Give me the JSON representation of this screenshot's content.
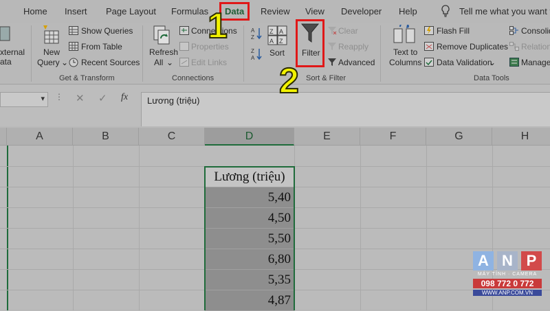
{
  "tabs": {
    "home": "Home",
    "insert": "Insert",
    "page_layout": "Page Layout",
    "formulas": "Formulas",
    "data": "Data",
    "review": "Review",
    "view": "View",
    "developer": "Developer",
    "help": "Help",
    "tell_me": "Tell me what you want to"
  },
  "ribbon": {
    "get_transform": {
      "external_line1": "xternal",
      "external_line2": "ata",
      "new_query_line1": "New",
      "new_query_line2": "Query",
      "show_queries": "Show Queries",
      "from_table": "From Table",
      "recent_sources": "Recent Sources",
      "group_label": "Get & Transform"
    },
    "connections": {
      "refresh_line1": "Refresh",
      "refresh_line2": "All",
      "connections": "Connections",
      "properties": "Properties",
      "edit_links": "Edit Links",
      "group_label": "Connections"
    },
    "sort_filter": {
      "sort": "Sort",
      "filter": "Filter",
      "clear": "Clear",
      "reapply": "Reapply",
      "advanced": "Advanced",
      "group_label": "Sort & Filter"
    },
    "data_tools": {
      "text_to_columns_line1": "Text to",
      "text_to_columns_line2": "Columns",
      "flash_fill": "Flash Fill",
      "remove_duplicates": "Remove Duplicates",
      "data_validation": "Data Validation",
      "consolidate": "Consolid",
      "relationships": "Relation",
      "manage": "Manage",
      "group_label": "Data Tools"
    }
  },
  "formula_bar": {
    "fx_label": "fx",
    "content": "Lương (triệu)"
  },
  "sheet": {
    "columns": [
      "A",
      "B",
      "C",
      "D",
      "E",
      "F",
      "G",
      "H"
    ],
    "selected_column": "D",
    "header_cell": "Lương (triệu)",
    "values": [
      "5,40",
      "4,50",
      "5,50",
      "6,80",
      "5,35",
      "4,87"
    ]
  },
  "annotations": {
    "step1": "1",
    "step2": "2"
  },
  "watermark": {
    "letter_a": "A",
    "letter_n": "N",
    "letter_p": "P",
    "tagline": "MÁY TÍNH · CAMERA",
    "phone": "098 772 0 772",
    "site": "WWW.ANP.COM.VN"
  },
  "colors": {
    "accent_green": "#1e6b3a",
    "highlight_red": "#e01818",
    "callout_yellow": "#f2f200"
  }
}
